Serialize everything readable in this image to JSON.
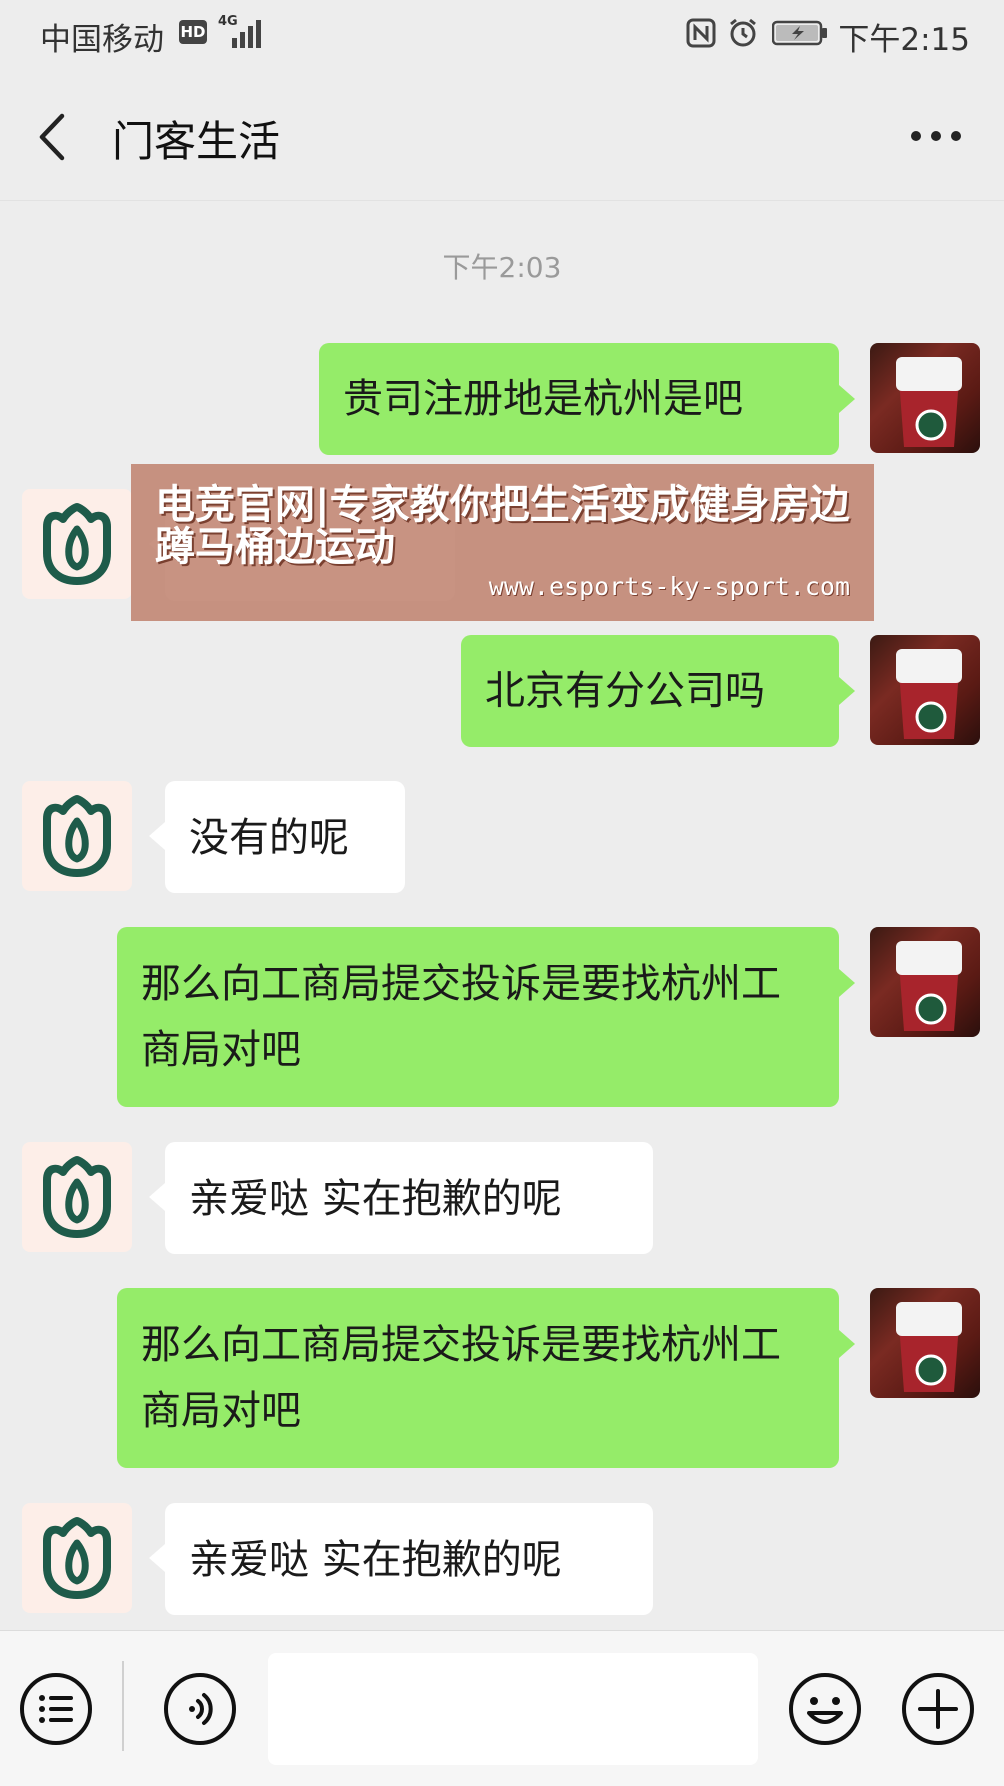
{
  "status_bar": {
    "carrier": "中国移动",
    "hd": "HD",
    "network": "4G",
    "time": "下午2:15"
  },
  "header": {
    "title": "门客生活",
    "back_icon": "chevron-left-icon",
    "more_icon": "more-dots-icon"
  },
  "chat": {
    "timestamp": "下午2:03",
    "messages": [
      {
        "sender": "self",
        "text": "贵司注册地是杭州是吧"
      },
      {
        "sender": "other",
        "text": ""
      },
      {
        "sender": "self",
        "text": "北京有分公司吗"
      },
      {
        "sender": "other",
        "text": "没有的呢"
      },
      {
        "sender": "self",
        "text": "那么向工商局提交投诉是要找杭州工商局对吧"
      },
      {
        "sender": "other",
        "text": "亲爱哒 实在抱歉的呢"
      },
      {
        "sender": "self",
        "text": "那么向工商局提交投诉是要找杭州工商局对吧"
      },
      {
        "sender": "other",
        "text": "亲爱哒 实在抱歉的呢"
      }
    ]
  },
  "overlay": {
    "title": "电竞官网|专家教你把生活变成健身房边蹲马桶边运动",
    "url": "www.esports-ky-sport.com"
  },
  "input_bar": {
    "menu_icon": "list-menu-icon",
    "voice_icon": "voice-icon",
    "emoji_icon": "emoji-icon",
    "plus_icon": "plus-icon",
    "message_value": ""
  },
  "colors": {
    "bubble_out": "#95ec69",
    "bubble_in": "#ffffff",
    "background": "#ededed",
    "bot_logo": "#1e5b4a"
  }
}
